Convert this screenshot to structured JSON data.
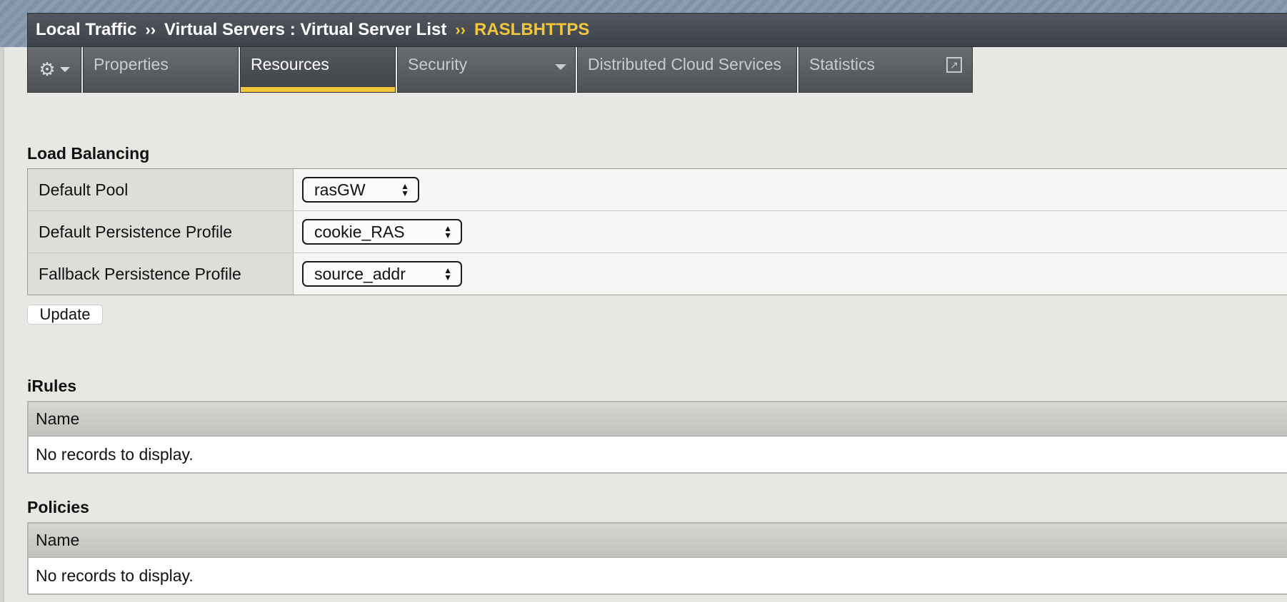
{
  "breadcrumb": {
    "part1": "Local Traffic",
    "sep1": "››",
    "part2": "Virtual Servers : Virtual Server List",
    "sep2": "››",
    "current": "RASLBHTTPS"
  },
  "tabs": {
    "gear_icon": "⚙",
    "properties": "Properties",
    "resources": "Resources",
    "security": "Security",
    "dcs": "Distributed Cloud Services",
    "statistics": "Statistics",
    "external_icon": "↗"
  },
  "load_balancing": {
    "title": "Load Balancing",
    "rows": [
      {
        "label": "Default Pool",
        "value": "rasGW"
      },
      {
        "label": "Default Persistence Profile",
        "value": "cookie_RAS"
      },
      {
        "label": "Fallback Persistence Profile",
        "value": "source_addr"
      }
    ],
    "update_label": "Update"
  },
  "irules": {
    "title": "iRules",
    "column": "Name",
    "empty": "No records to display."
  },
  "policies": {
    "title": "Policies",
    "column": "Name",
    "empty": "No records to display."
  },
  "colors": {
    "accent": "#f2c63b",
    "header_bg": "#474c54",
    "page_bg": "#e8e7e3"
  }
}
